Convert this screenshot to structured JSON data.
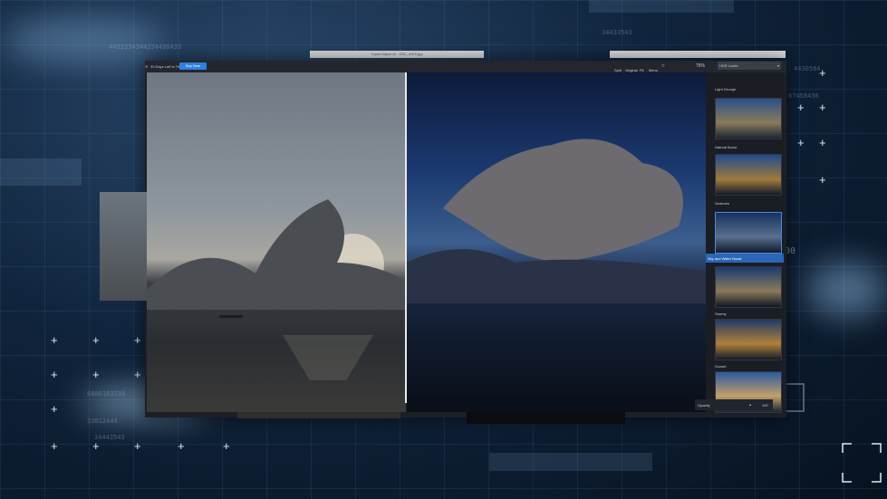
{
  "background": {
    "digits": [
      "4433334344334486433",
      "34433543",
      "4430584",
      "67458436",
      "6800163739",
      "33012444",
      "34443543"
    ],
    "side_label": "00"
  },
  "window": {
    "title": "Topaz Adjust AI - DSC_4915.jpg",
    "trial_text": "30 Days Left in Trial",
    "buy_label": "Buy Now",
    "view_modes": [
      "Split",
      "Original",
      "Fit",
      "Menu"
    ],
    "zoom": "75%",
    "preset_dropdown": "HDR Looks"
  },
  "presets": [
    {
      "label": "Light Grunge",
      "selected": false
    },
    {
      "label": "Natural Boost",
      "selected": false
    },
    {
      "label": "Seafoam",
      "selected": false
    },
    {
      "label": "Sky and Water Boost",
      "selected": true
    },
    {
      "label": "Stormy",
      "selected": false
    },
    {
      "label": "Sunset",
      "selected": false
    }
  ],
  "opacity": {
    "label": "Opacity",
    "value": "100"
  },
  "colors": {
    "accent": "#2e7fe0",
    "panel": "#1a1d24",
    "selected": "#2a66b5"
  }
}
